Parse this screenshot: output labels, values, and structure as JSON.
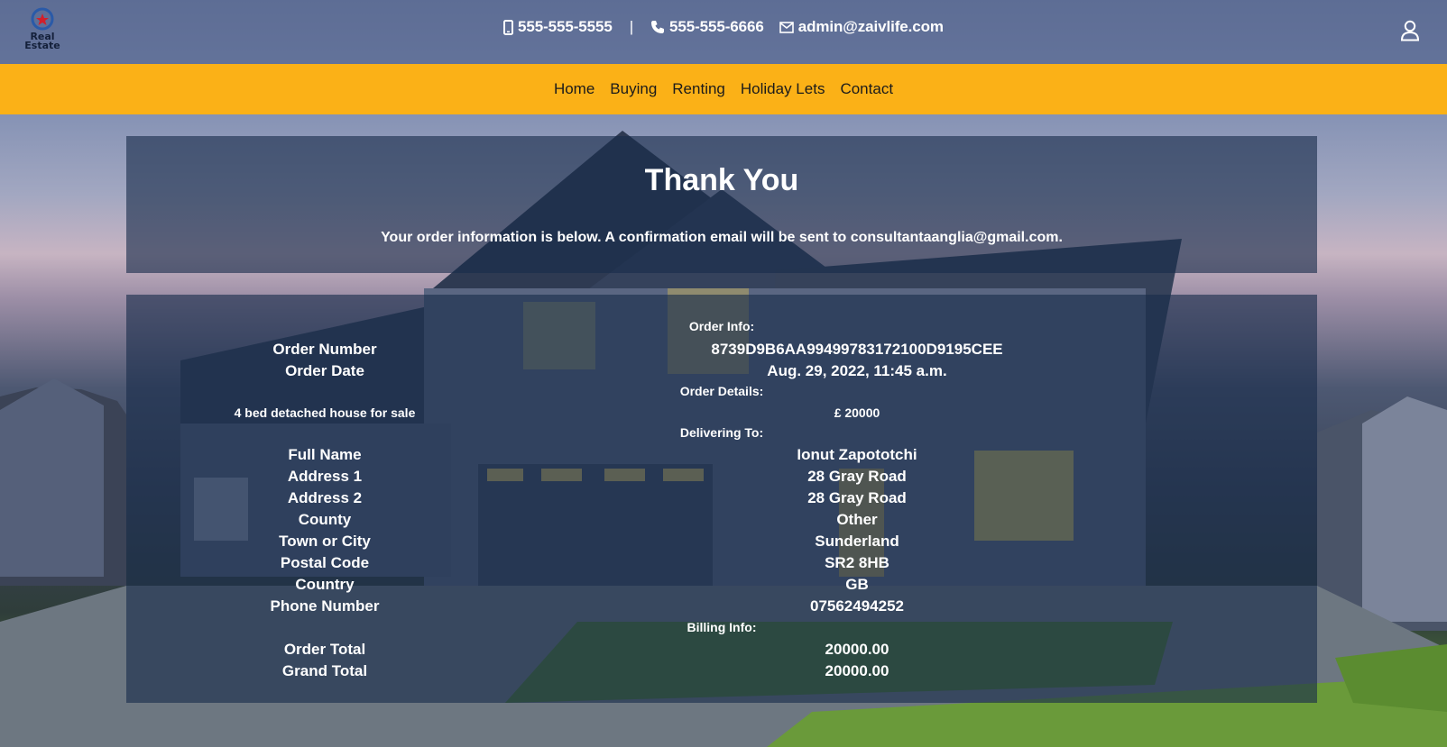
{
  "header": {
    "logo_text_line1": "Real",
    "logo_text_line2": "Estate",
    "mobile": "555-555-5555",
    "separator": "|",
    "phone": "555-555-6666",
    "email": "admin@zaivlife.com",
    "icons": [
      "mobile-icon",
      "phone-icon",
      "envelope-icon",
      "user-icon"
    ]
  },
  "nav": {
    "items": [
      "Home",
      "Buying",
      "Renting",
      "Holiday Lets",
      "Contact"
    ]
  },
  "thanks": {
    "title": "Thank You",
    "message": "Your order information is below. A confirmation email will be sent to consultantaanglia@gmail.com."
  },
  "order": {
    "order_info_heading": "Order Info:",
    "order_number_label": "Order Number",
    "order_number": "8739D9B6AA99499783172100D9195CEE",
    "order_date_label": "Order Date",
    "order_date": "Aug. 29, 2022, 11:45 a.m.",
    "details_heading": "Order Details:",
    "item_name": "4 bed detached house for sale",
    "item_price": "£ 20000",
    "delivering_heading": "Delivering To:",
    "delivery": [
      {
        "label": "Full Name",
        "value": "Ionut Zapototchi"
      },
      {
        "label": "Address 1",
        "value": "28 Gray Road"
      },
      {
        "label": "Address 2",
        "value": "28 Gray Road"
      },
      {
        "label": "County",
        "value": "Other"
      },
      {
        "label": "Town or City",
        "value": "Sunderland"
      },
      {
        "label": "Postal Code",
        "value": "SR2 8HB"
      },
      {
        "label": "Country",
        "value": "GB"
      },
      {
        "label": "Phone Number",
        "value": "07562494252"
      }
    ],
    "billing_heading": "Billing Info:",
    "order_total_label": "Order Total",
    "order_total": "20000.00",
    "grand_total_label": "Grand Total",
    "grand_total": "20000.00"
  },
  "colors": {
    "nav_bg": "#fbb117",
    "panel_bg": "#182c4a",
    "topbar_bg": "#50608a",
    "text": "#ffffff"
  }
}
